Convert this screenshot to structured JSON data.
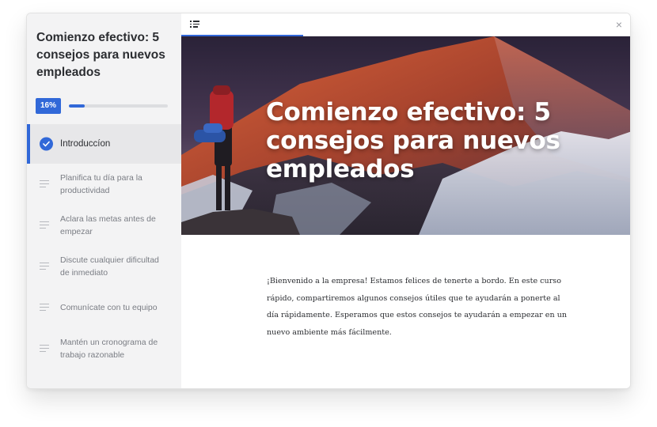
{
  "sidebar": {
    "course_title": "Comienzo efectivo: 5 consejos para nuevos empleados",
    "progress_label": "16%",
    "progress_value": 0.16,
    "lessons": [
      {
        "label": "Introduccíon",
        "completed": true,
        "active": true
      },
      {
        "label": "Planifica tu día para la productividad",
        "completed": false,
        "active": false
      },
      {
        "label": "Aclara las metas antes de empezar",
        "completed": false,
        "active": false
      },
      {
        "label": "Discute cualquier dificultad de inmediato",
        "completed": false,
        "active": false
      },
      {
        "label": "Comunícate con tu equipo",
        "completed": false,
        "active": false
      },
      {
        "label": "Mantén un cronograma de trabajo razonable",
        "completed": false,
        "active": false
      }
    ]
  },
  "topbar": {
    "toc_icon": "list-icon",
    "close_icon": "close-icon"
  },
  "hero": {
    "title": "Comienzo efectivo: 5 consejos para nuevos empleados"
  },
  "content": {
    "paragraph": "¡Bienvenido a la empresa! Estamos felices de tenerte a bordo. En este curso rápido, compartiremos algunos consejos útiles que te ayudarán a ponerte al día rápidamente. Esperamos que estos consejos te ayudarán a empezar en un nuevo ambiente más fácilmente."
  },
  "colors": {
    "accent": "#3168d8",
    "sidebar_bg": "#f3f3f4"
  }
}
